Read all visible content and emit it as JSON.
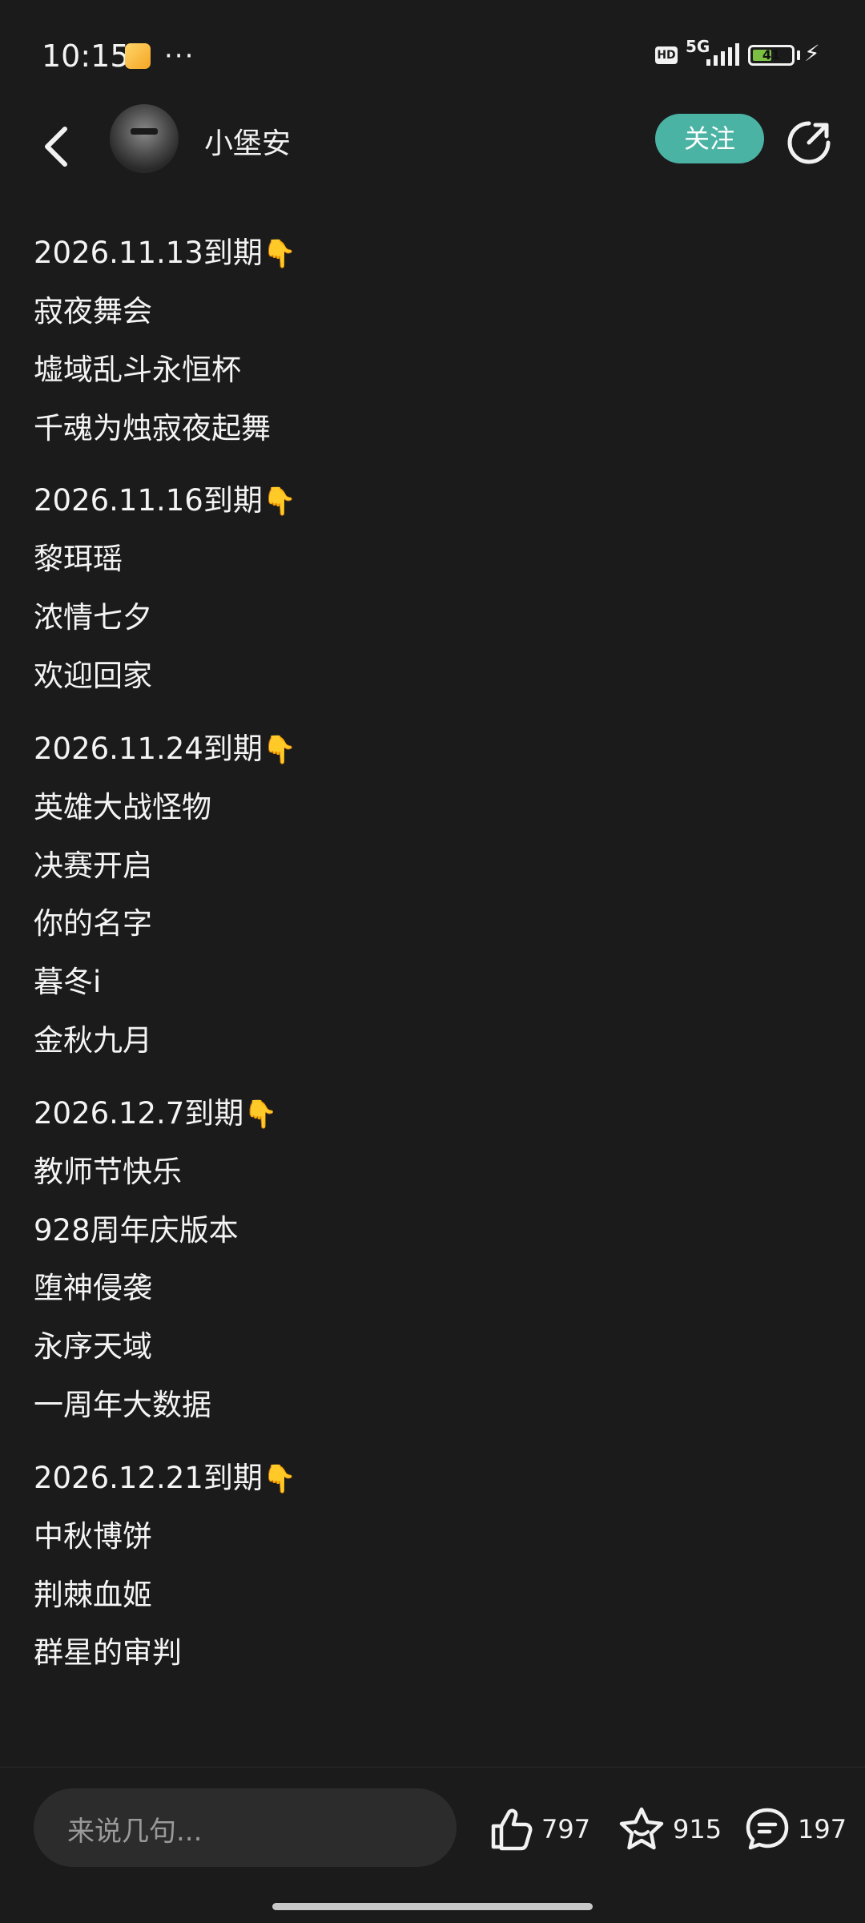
{
  "status": {
    "time": "10:15",
    "more": "···",
    "hd": "HD",
    "network": "5G",
    "battery": "41"
  },
  "header": {
    "username": "小堡安",
    "follow_label": "关注"
  },
  "sections": [
    {
      "date": "2026.11.13到期",
      "emoji": "👇",
      "items": [
        "寂夜舞会",
        "墟域乱斗永恒杯",
        "千魂为烛寂夜起舞"
      ]
    },
    {
      "date": "2026.11.16到期",
      "emoji": "👇",
      "items": [
        "黎珥瑶",
        "浓情七夕",
        "欢迎回家"
      ]
    },
    {
      "date": "2026.11.24到期",
      "emoji": "👇",
      "items": [
        "英雄大战怪物",
        "决赛开启",
        "你的名字",
        "暮冬i",
        "金秋九月"
      ]
    },
    {
      "date": "2026.12.7到期",
      "emoji": "👇",
      "items": [
        "教师节快乐",
        "928周年庆版本",
        "堕神侵袭",
        "永序天域",
        "一周年大数据"
      ]
    },
    {
      "date": "2026.12.21到期",
      "emoji": "👇",
      "items": [
        "中秋博饼",
        "荆棘血姬",
        "群星的审判"
      ]
    }
  ],
  "bottom": {
    "comment_placeholder": "来说几句...",
    "likes": "797",
    "favorites": "915",
    "comments": "197"
  }
}
